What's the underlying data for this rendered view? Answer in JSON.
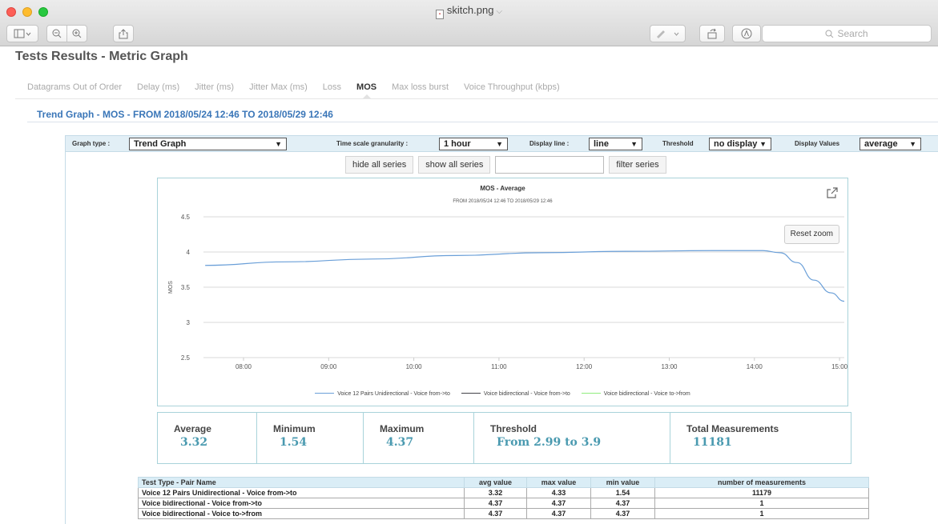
{
  "window": {
    "title": "skitch.png",
    "search_placeholder": "Search"
  },
  "page": {
    "title": "Tests Results - Metric Graph",
    "tabs": [
      {
        "label": "Datagrams Out of Order",
        "active": false
      },
      {
        "label": "Delay (ms)",
        "active": false
      },
      {
        "label": "Jitter (ms)",
        "active": false
      },
      {
        "label": "Jitter Max (ms)",
        "active": false
      },
      {
        "label": "Loss",
        "active": false
      },
      {
        "label": "MOS",
        "active": true
      },
      {
        "label": "Max loss burst",
        "active": false
      },
      {
        "label": "Voice Throughput (kbps)",
        "active": false
      }
    ],
    "trend_title": "Trend Graph - MOS - FROM 2018/05/24 12:46 TO 2018/05/29 12:46"
  },
  "controls": {
    "graph_type_label": "Graph type :",
    "graph_type_value": "Trend Graph",
    "time_scale_label": "Time scale granularity :",
    "time_scale_value": "1 hour",
    "display_line_label": "Display line :",
    "display_line_value": "line",
    "threshold_label": "Threshold",
    "threshold_value": "no display",
    "display_values_label": "Display Values",
    "display_values_value": "average",
    "hide_all": "hide all series",
    "show_all": "show all series",
    "filter_placeholder": "",
    "filter_series": "filter series"
  },
  "chart": {
    "reset_zoom": "Reset zoom"
  },
  "chart_data": {
    "type": "line",
    "title": "MOS - Average",
    "subtitle": "FROM 2018/05/24 12:46 TO 2018/05/29 12:46",
    "ylabel": "MOS",
    "xlabel": "",
    "ylim": [
      2.5,
      4.5
    ],
    "yticks": [
      "4.5",
      "4",
      "3.5",
      "3",
      "2.5"
    ],
    "xticks": [
      "08:00",
      "09:00",
      "10:00",
      "11:00",
      "12:00",
      "13:00",
      "14:00",
      "15:00"
    ],
    "grid": true,
    "legend_position": "bottom",
    "series": [
      {
        "name": "Voice 12 Pairs Unidirectional - Voice from->to",
        "color": "#6a9fd8",
        "points": [
          [
            7.55,
            3.81
          ],
          [
            8.5,
            3.86
          ],
          [
            9.5,
            3.9
          ],
          [
            10.5,
            3.95
          ],
          [
            11.5,
            3.99
          ],
          [
            12.5,
            4.01
          ],
          [
            13.5,
            4.02
          ],
          [
            14.1,
            4.02
          ],
          [
            14.3,
            3.99
          ],
          [
            14.5,
            3.85
          ],
          [
            14.7,
            3.6
          ],
          [
            14.9,
            3.42
          ],
          [
            15.2,
            3.3
          ]
        ]
      },
      {
        "name": "Voice bidirectional - Voice from->to",
        "color": "#434348",
        "points": []
      },
      {
        "name": "Voice bidirectional - Voice to->from",
        "color": "#90ed7d",
        "points": []
      }
    ]
  },
  "stats": {
    "average_label": "Average",
    "average_value": "3.32",
    "minimum_label": "Minimum",
    "minimum_value": "1.54",
    "maximum_label": "Maximum",
    "maximum_value": "4.37",
    "threshold_label": "Threshold",
    "threshold_value": "From 2.99 to 3.9",
    "total_label": "Total Measurements",
    "total_value": "11181"
  },
  "table": {
    "headers": [
      "Test Type - Pair Name",
      "avg value",
      "max value",
      "min value",
      "number of measurements"
    ],
    "rows": [
      [
        "Voice 12 Pairs Unidirectional - Voice from->to",
        "3.32",
        "4.33",
        "1.54",
        "11179"
      ],
      [
        "Voice bidirectional - Voice from->to",
        "4.37",
        "4.37",
        "4.37",
        "1"
      ],
      [
        "Voice bidirectional - Voice to->from",
        "4.37",
        "4.37",
        "4.37",
        "1"
      ]
    ]
  }
}
